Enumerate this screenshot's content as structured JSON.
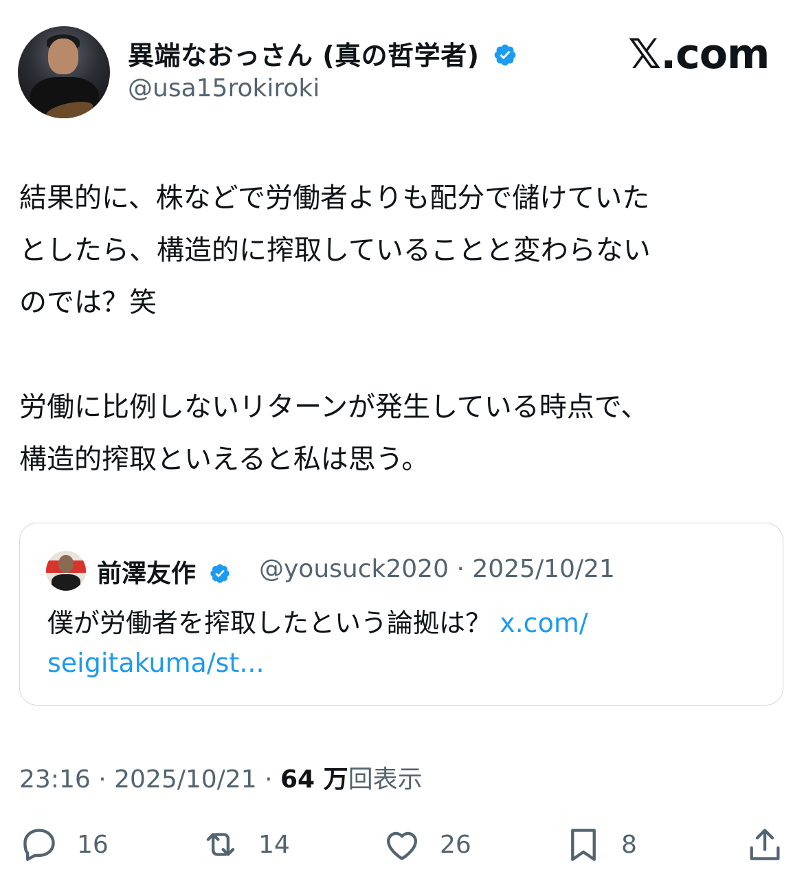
{
  "author": {
    "display_name": "異端なおっさん (真の哲学者)",
    "handle": "@usa15rokiroki",
    "verified": true
  },
  "brand": "𝕏.com",
  "tweet": {
    "paragraph1": "結果的に、株などで労働者よりも配分で儲けていた\nとしたら、構造的に搾取していることと変わらない\nのでは？笑",
    "paragraph2": "労働に比例しないリターンが発生している時点で、\n構造的搾取といえると私は思う。"
  },
  "quoted_tweet": {
    "display_name": "前澤友作",
    "handle": "@yousuck2020",
    "separator": "·",
    "date": "2025/10/21",
    "text": "僕が労働者を搾取したという論拠は？",
    "link_part1": "x.com/",
    "link_part2": "seigitakuma/st..."
  },
  "meta": {
    "time": "23:16",
    "separator": "·",
    "date": "2025/10/21",
    "views_count": "64 万",
    "views_label": "回表示"
  },
  "actions": {
    "replies": "16",
    "retweets": "14",
    "likes": "26",
    "bookmarks": "8"
  },
  "colors": {
    "text": "#0f1419",
    "secondary": "#536471",
    "link": "#1d9bf0",
    "verified": "#1d9bf0",
    "border": "#cfd9de"
  }
}
